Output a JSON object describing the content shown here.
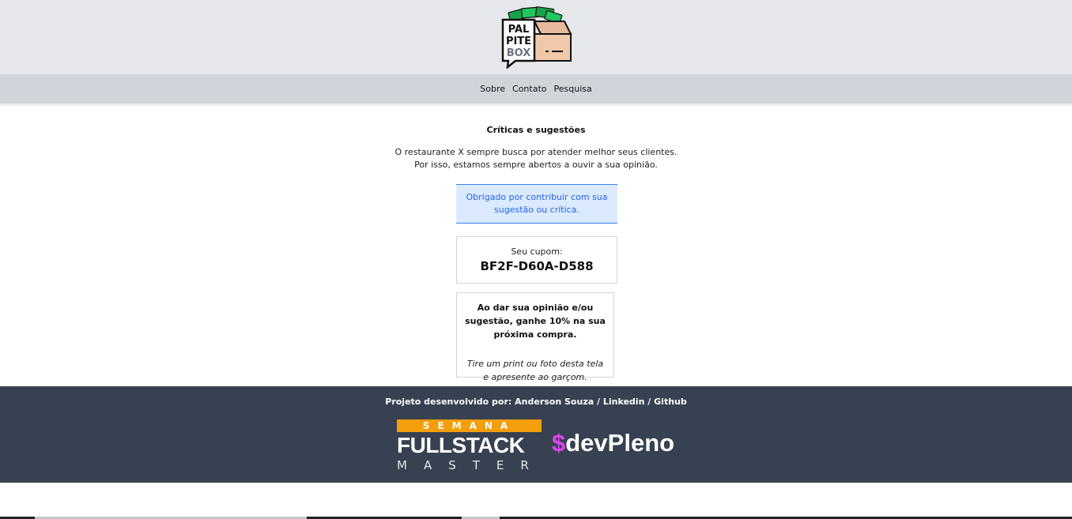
{
  "header": {
    "logo": {
      "line1": "PAL",
      "line2": "PITE",
      "line3": "BOX",
      "alt_icon": "palpitebox-logo"
    }
  },
  "nav": {
    "items": [
      {
        "label": "Sobre"
      },
      {
        "label": "Contato"
      },
      {
        "label": "Pesquisa"
      }
    ]
  },
  "main": {
    "title": "Críticas e sugestões",
    "intro_line1": "O restaurante X sempre busca por atender melhor seus clientes.",
    "intro_line2": "Por isso, estamos sempre abertos a ouvir a sua opinião.",
    "thanks_message": "Obrigado por contribuir com sua sugestão ou crítica.",
    "coupon": {
      "label": "Seu cupom:",
      "code": "BF2F-D60A-D588"
    },
    "promo": {
      "bold_text": "Ao dar sua opinião e/ou sugestão, ganhe 10% na sua próxima compra.",
      "italic_text": "Tire um print ou foto desta tela e apresente ao garçom."
    }
  },
  "footer": {
    "credits_prefix": "Projeto desenvolvido por: Anderson Souza /",
    "linkedin_label": "Linkedin",
    "separator": "/",
    "github_label": "Github",
    "fullstack_logo": {
      "top": "SEMANA",
      "middle": "FULLSTACK",
      "bottom": "MASTER"
    },
    "devpleno_logo": {
      "dollar": "$",
      "text": "devPleno"
    }
  },
  "colors": {
    "header_bg": "#e5e7eb",
    "nav_bg": "#d1d5db",
    "thanks_bg": "#dbeafe",
    "thanks_border": "#3b82f6",
    "footer_bg": "#374151",
    "accent_orange": "#f59e0b",
    "accent_magenta": "#d946ef"
  }
}
